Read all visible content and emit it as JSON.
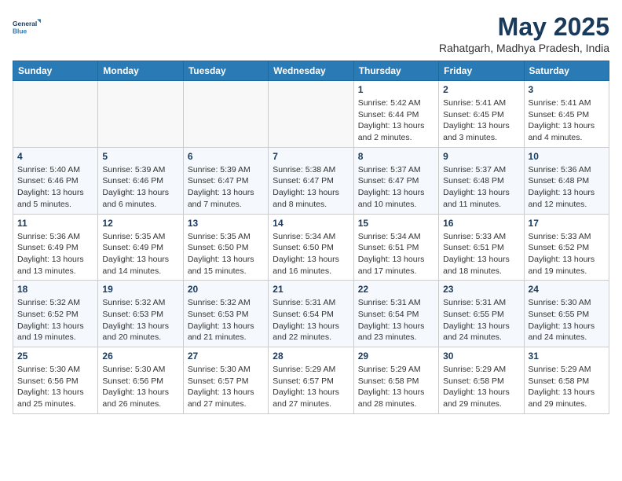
{
  "logo": {
    "line1": "General",
    "line2": "Blue"
  },
  "title": "May 2025",
  "subtitle": "Rahatgarh, Madhya Pradesh, India",
  "weekdays": [
    "Sunday",
    "Monday",
    "Tuesday",
    "Wednesday",
    "Thursday",
    "Friday",
    "Saturday"
  ],
  "weeks": [
    [
      {
        "day": "",
        "empty": true
      },
      {
        "day": "",
        "empty": true
      },
      {
        "day": "",
        "empty": true
      },
      {
        "day": "",
        "empty": true
      },
      {
        "day": "1",
        "sunrise": "5:42 AM",
        "sunset": "6:44 PM",
        "daylight": "13 hours and 2 minutes."
      },
      {
        "day": "2",
        "sunrise": "5:41 AM",
        "sunset": "6:45 PM",
        "daylight": "13 hours and 3 minutes."
      },
      {
        "day": "3",
        "sunrise": "5:41 AM",
        "sunset": "6:45 PM",
        "daylight": "13 hours and 4 minutes."
      }
    ],
    [
      {
        "day": "4",
        "sunrise": "5:40 AM",
        "sunset": "6:46 PM",
        "daylight": "13 hours and 5 minutes."
      },
      {
        "day": "5",
        "sunrise": "5:39 AM",
        "sunset": "6:46 PM",
        "daylight": "13 hours and 6 minutes."
      },
      {
        "day": "6",
        "sunrise": "5:39 AM",
        "sunset": "6:47 PM",
        "daylight": "13 hours and 7 minutes."
      },
      {
        "day": "7",
        "sunrise": "5:38 AM",
        "sunset": "6:47 PM",
        "daylight": "13 hours and 8 minutes."
      },
      {
        "day": "8",
        "sunrise": "5:37 AM",
        "sunset": "6:47 PM",
        "daylight": "13 hours and 10 minutes."
      },
      {
        "day": "9",
        "sunrise": "5:37 AM",
        "sunset": "6:48 PM",
        "daylight": "13 hours and 11 minutes."
      },
      {
        "day": "10",
        "sunrise": "5:36 AM",
        "sunset": "6:48 PM",
        "daylight": "13 hours and 12 minutes."
      }
    ],
    [
      {
        "day": "11",
        "sunrise": "5:36 AM",
        "sunset": "6:49 PM",
        "daylight": "13 hours and 13 minutes."
      },
      {
        "day": "12",
        "sunrise": "5:35 AM",
        "sunset": "6:49 PM",
        "daylight": "13 hours and 14 minutes."
      },
      {
        "day": "13",
        "sunrise": "5:35 AM",
        "sunset": "6:50 PM",
        "daylight": "13 hours and 15 minutes."
      },
      {
        "day": "14",
        "sunrise": "5:34 AM",
        "sunset": "6:50 PM",
        "daylight": "13 hours and 16 minutes."
      },
      {
        "day": "15",
        "sunrise": "5:34 AM",
        "sunset": "6:51 PM",
        "daylight": "13 hours and 17 minutes."
      },
      {
        "day": "16",
        "sunrise": "5:33 AM",
        "sunset": "6:51 PM",
        "daylight": "13 hours and 18 minutes."
      },
      {
        "day": "17",
        "sunrise": "5:33 AM",
        "sunset": "6:52 PM",
        "daylight": "13 hours and 19 minutes."
      }
    ],
    [
      {
        "day": "18",
        "sunrise": "5:32 AM",
        "sunset": "6:52 PM",
        "daylight": "13 hours and 19 minutes."
      },
      {
        "day": "19",
        "sunrise": "5:32 AM",
        "sunset": "6:53 PM",
        "daylight": "13 hours and 20 minutes."
      },
      {
        "day": "20",
        "sunrise": "5:32 AM",
        "sunset": "6:53 PM",
        "daylight": "13 hours and 21 minutes."
      },
      {
        "day": "21",
        "sunrise": "5:31 AM",
        "sunset": "6:54 PM",
        "daylight": "13 hours and 22 minutes."
      },
      {
        "day": "22",
        "sunrise": "5:31 AM",
        "sunset": "6:54 PM",
        "daylight": "13 hours and 23 minutes."
      },
      {
        "day": "23",
        "sunrise": "5:31 AM",
        "sunset": "6:55 PM",
        "daylight": "13 hours and 24 minutes."
      },
      {
        "day": "24",
        "sunrise": "5:30 AM",
        "sunset": "6:55 PM",
        "daylight": "13 hours and 24 minutes."
      }
    ],
    [
      {
        "day": "25",
        "sunrise": "5:30 AM",
        "sunset": "6:56 PM",
        "daylight": "13 hours and 25 minutes."
      },
      {
        "day": "26",
        "sunrise": "5:30 AM",
        "sunset": "6:56 PM",
        "daylight": "13 hours and 26 minutes."
      },
      {
        "day": "27",
        "sunrise": "5:30 AM",
        "sunset": "6:57 PM",
        "daylight": "13 hours and 27 minutes."
      },
      {
        "day": "28",
        "sunrise": "5:29 AM",
        "sunset": "6:57 PM",
        "daylight": "13 hours and 27 minutes."
      },
      {
        "day": "29",
        "sunrise": "5:29 AM",
        "sunset": "6:58 PM",
        "daylight": "13 hours and 28 minutes."
      },
      {
        "day": "30",
        "sunrise": "5:29 AM",
        "sunset": "6:58 PM",
        "daylight": "13 hours and 29 minutes."
      },
      {
        "day": "31",
        "sunrise": "5:29 AM",
        "sunset": "6:58 PM",
        "daylight": "13 hours and 29 minutes."
      }
    ]
  ]
}
